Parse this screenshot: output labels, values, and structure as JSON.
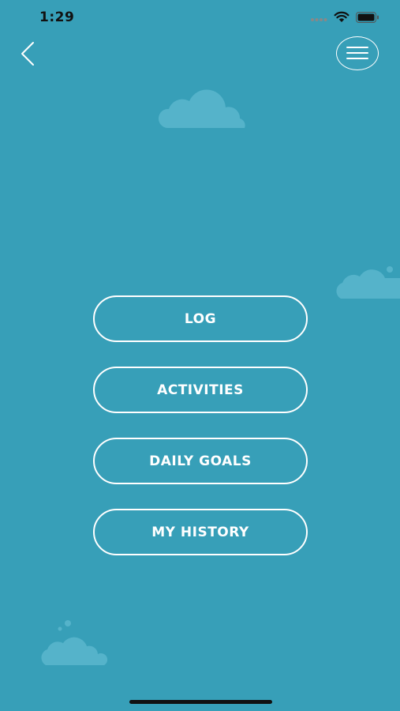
{
  "status_bar": {
    "time": "1:29",
    "icons": [
      "signal-icon",
      "wifi-icon",
      "battery-icon"
    ]
  },
  "header": {
    "back_icon": "chevron-left-icon",
    "menu_icon": "hamburger-menu-icon"
  },
  "menu": {
    "items": [
      {
        "label": "LOG"
      },
      {
        "label": "ACTIVITIES"
      },
      {
        "label": "DAILY GOALS"
      },
      {
        "label": "MY HISTORY"
      }
    ]
  },
  "colors": {
    "background": "#379fb8",
    "button_border": "#ffffff",
    "button_text": "#ffffff",
    "cloud": "#55b3ca"
  }
}
